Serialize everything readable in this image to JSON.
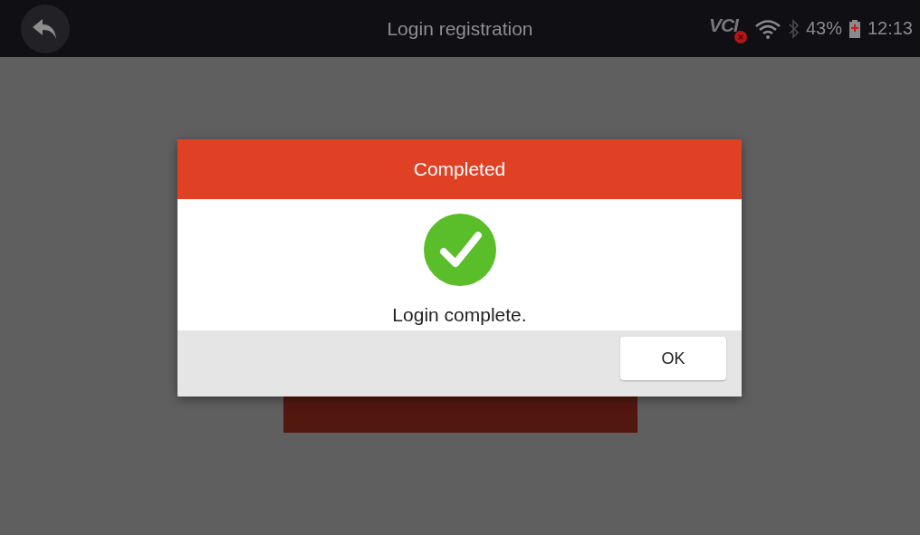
{
  "top_bar": {
    "title": "Login registration",
    "status": {
      "vci_label": "VCI",
      "battery": "43%",
      "time": "12:13"
    }
  },
  "dialog": {
    "title": "Completed",
    "message": "Login complete.",
    "buttons": [
      "OK"
    ]
  }
}
